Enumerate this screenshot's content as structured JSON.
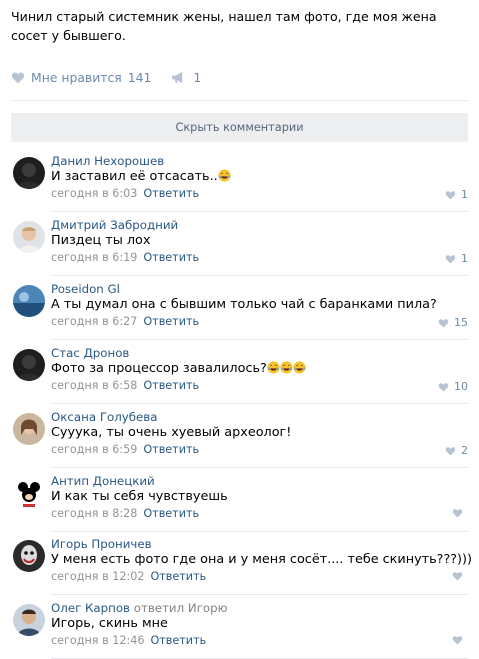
{
  "post": {
    "text": "Чинил старый системник жены, нашел там фото, где моя жена сосет у бывшего.",
    "like_label": "Мне нравится",
    "like_count": "141",
    "share_count": "1"
  },
  "hide_comments_label": "Скрыть комментарии",
  "comments": [
    {
      "author": "Данил Нехорошев",
      "text": "И заставил её отсасать..",
      "emoji_count": 1,
      "time": "сегодня в 6:03",
      "reply": "Ответить",
      "likes": "1",
      "avatar": "dark-avatar"
    },
    {
      "author": "Дмитрий Забродний",
      "text": "Пиздец ты лох",
      "emoji_count": 0,
      "time": "сегодня в 6:19",
      "reply": "Ответить",
      "likes": "1",
      "avatar": "man-avatar"
    },
    {
      "author": "Poseidon Gl",
      "text": "А ты думал она с бывшим только чай с баранками пила?",
      "emoji_count": 0,
      "time": "сегодня в 6:27",
      "reply": "Ответить",
      "likes": "15",
      "avatar": "sea-avatar"
    },
    {
      "author": "Стас Дронов",
      "text": "Фото за процессор завалилось?",
      "emoji_count": 3,
      "time": "сегодня в 6:58",
      "reply": "Ответить",
      "likes": "10",
      "avatar": "dark-avatar"
    },
    {
      "author": "Оксана Голубева",
      "text": "Сууука, ты очень хуевый археолог!",
      "emoji_count": 0,
      "time": "сегодня в 6:59",
      "reply": "Ответить",
      "likes": "2",
      "avatar": "woman-avatar"
    },
    {
      "author": "Антип Донецкий",
      "text": "И как ты себя чувствуешь",
      "emoji_count": 0,
      "time": "сегодня в 8:28",
      "reply": "Ответить",
      "likes": "",
      "avatar": "mickey-avatar"
    },
    {
      "author": "Игорь Проничев",
      "text": "У меня есть фото где она и у меня сосёт.... тебе скинуть???)))",
      "emoji_count": 0,
      "time": "сегодня в 12:02",
      "reply": "Ответить",
      "likes": "",
      "avatar": "joker-avatar"
    },
    {
      "author": "Олег Карпов",
      "reply_note": "ответил Игорю",
      "text": "Игорь, скинь мне",
      "emoji_count": 0,
      "time": "сегодня в 12:46",
      "reply": "Ответить",
      "likes": "",
      "avatar": "man2-avatar"
    }
  ],
  "colors": {
    "link": "#2a5885",
    "muted": "#939393",
    "like": "#6b8aab",
    "button_bg": "#edeef0"
  }
}
